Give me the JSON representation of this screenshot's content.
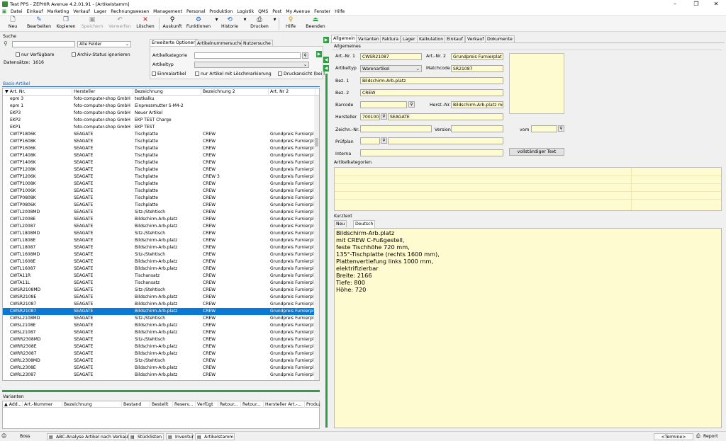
{
  "window": {
    "title": "Test PPS - ZEPHIR Avenue 4.2.01.91 - [Artikelstamm]",
    "controls": [
      "–",
      "❐",
      "✕"
    ]
  },
  "menu": [
    "Datei",
    "Einkauf",
    "Marketing",
    "Verkauf",
    "Lager",
    "Rechnungswesen",
    "Management",
    "Personal",
    "Produktion",
    "Logistik",
    "QMS",
    "Post",
    "My Avenue",
    "Fenster",
    "Hilfe"
  ],
  "toolbar": {
    "neu": "Neu",
    "bearbeiten": "Bearbeiten",
    "kopieren": "Kopieren",
    "speichern": "Speichern",
    "verwerfen": "Verwerfen",
    "loeschen": "Löschen",
    "auskunft": "Auskunft",
    "funktionen": "Funktionen",
    "historie": "Historie",
    "drucken": "Drucken",
    "hilfe": "Hilfe",
    "beenden": "Beenden"
  },
  "search": {
    "label": "Suche",
    "value": "",
    "field_select": "Alle Felder",
    "nur_verfuegbare": "nur Verfügbare",
    "archiv_status": "Archiv-Status ignorieren",
    "datensaetze_label": "Datensätze:",
    "datensaetze": "1616",
    "tabs": [
      "Erweiterte Optionen",
      "Artikelnummersuche",
      "Nutzersuche"
    ],
    "artikelkategorie_label": "Artikelkategorie",
    "artikeltyp_label": "Artikeltyp",
    "einmalartikel": "Einmalartikel",
    "loeschmarkierung": "nur Artikel mit Löschmarkierung",
    "druckansicht": "Druckansicht (bei l"
  },
  "grid": {
    "section_title": "Basis-Artikel",
    "columns": [
      "▼ Art. Nr.",
      "Hersteller",
      "Bezeichnung",
      "Bezeichnung 2",
      "Art. Nr 2"
    ],
    "selected_index": 30,
    "rows": [
      [
        "epm 3",
        "foto-computer-shop GmbH",
        "testkalku",
        "",
        ""
      ],
      [
        "epm 1",
        "foto-computer-shop GmbH",
        "Einpressmutter S-M4-2",
        "",
        ""
      ],
      [
        "EKP3",
        "foto-computer-shop GmbH",
        "Neuer Artikel",
        "",
        ""
      ],
      [
        "EKP2",
        "foto-computer-shop GmbH",
        "EKP TEST Charge",
        "",
        ""
      ],
      [
        "EKP1",
        "foto-computer-shop GmbH",
        "EKP TEST",
        "",
        ""
      ],
      [
        "CWTP1806K",
        "SEAGATE",
        "Tischplatte",
        "CREW",
        "Grundpreis Furnierpl"
      ],
      [
        "CWTP1608K",
        "SEAGATE",
        "Tischplatte",
        "CREW",
        "Grundpreis Furnierpl"
      ],
      [
        "CWTP1606K",
        "SEAGATE",
        "Tischplatte",
        "CREW",
        "Grundpreis Furnierpl"
      ],
      [
        "CWTP1408K",
        "SEAGATE",
        "Tischplatte",
        "CREW",
        "Grundpreis Furnierpl"
      ],
      [
        "CWTP1406K",
        "SEAGATE",
        "Tischplatte",
        "CREW",
        "Grundpreis Furnierpl"
      ],
      [
        "CWTP1208K",
        "SEAGATE",
        "Tischplatte",
        "CREW",
        "Grundpreis Furnierpl"
      ],
      [
        "CWTP1206K",
        "SEAGATE",
        "Tischplatte",
        "CREW 3",
        "Grundpreis Furnierpl"
      ],
      [
        "CWTP1008K",
        "SEAGATE",
        "Tischplatte",
        "CREW",
        "Grundpreis Furnierpl"
      ],
      [
        "CWTP1006K",
        "SEAGATE",
        "Tischplatte",
        "CREW",
        "Grundpreis Furnierpl"
      ],
      [
        "CWTP0808K",
        "SEAGATE",
        "Tischplatte",
        "CREW",
        "Grundpreis Furnierpl"
      ],
      [
        "CWTP0806K",
        "SEAGATE",
        "Tischplatte",
        "CREW",
        "Grundpreis Furnierpl"
      ],
      [
        "CWTL2008MD",
        "SEAGATE",
        "Sitz-/Stehtisch",
        "CREW",
        "Grundpreis Furnierpl"
      ],
      [
        "CWTL2008E",
        "SEAGATE",
        "Bildschirm-Arb.platz",
        "CREW",
        "Grundpreis Furnierpl"
      ],
      [
        "CWTL20087",
        "SEAGATE",
        "Bildschirm-Arb.platz",
        "CREW",
        "Grundpreis Furnierpl"
      ],
      [
        "CWTL1808MD",
        "SEAGATE",
        "Sitz-/Stehtisch",
        "CREW",
        "Grundpreis Furnierpl"
      ],
      [
        "CWTL1808E",
        "SEAGATE",
        "Bildschirm-Arb.platz",
        "CREW",
        "Grundpreis Furnierpl"
      ],
      [
        "CWTL18087",
        "SEAGATE",
        "Bildschirm-Arb.platz",
        "CREW",
        "Grundpreis Furnierpl"
      ],
      [
        "CWTL1608MD",
        "SEAGATE",
        "Sitz-/Stehtisch",
        "CREW",
        "Grundpreis Furnierpl"
      ],
      [
        "CWTL1608E",
        "SEAGATE",
        "Bildschirm-Arb.platz",
        "CREW",
        "Grundpreis Furnierpl"
      ],
      [
        "CWTL16087",
        "SEAGATE",
        "Bildschirm-Arb.platz",
        "CREW",
        "Grundpreis Furnierpl"
      ],
      [
        "CWTA11R",
        "SEAGATE",
        "Tischansatz",
        "CREW",
        "Grundpreis Furnierpl"
      ],
      [
        "CWTA11L",
        "SEAGATE",
        "Tischansatz",
        "CREW",
        "Grundpreis Furnierpl"
      ],
      [
        "CWSR2108MD",
        "SEAGATE",
        "Sitz-/Stehtisch",
        "CREW",
        "Grundpreis Furnierpl"
      ],
      [
        "CWSR2108E",
        "SEAGATE",
        "Bildschirm-Arb.platz",
        "CREW",
        "Grundpreis Furnierpl"
      ],
      [
        "CWSR21087",
        "SEAGATE",
        "Bildschirm-Arb.platz",
        "CREW",
        "Grundpreis Furnierpl"
      ],
      [
        "CWSR21087",
        "SEAGATE",
        "Bildschirm-Arb.platz",
        "CREW",
        "Grundpreis Furnierpl"
      ],
      [
        "CWSL2108MD",
        "SEAGATE",
        "Sitz-/Stehtisch",
        "CREW",
        "Grundpreis Furnierpl"
      ],
      [
        "CWSL2108E",
        "SEAGATE",
        "Bildschirm-Arb.platz",
        "CREW",
        "Grundpreis Furnierpl"
      ],
      [
        "CWSL21087",
        "SEAGATE",
        "Bildschirm-Arb.platz",
        "CREW",
        "Grundpreis Furnierpl"
      ],
      [
        "CWRR2308MD",
        "SEAGATE",
        "Sitz-/Stehtisch",
        "CREW",
        "Grundpreis Furnierpl"
      ],
      [
        "CWRR2308E",
        "SEAGATE",
        "Bildschirm-Arb.platz",
        "CREW",
        "Grundpreis Furnierpl"
      ],
      [
        "CWRR23087",
        "SEAGATE",
        "Bildschirm-Arb.platz",
        "CREW",
        "Grundpreis Furnierpl"
      ],
      [
        "CWRL2308MD",
        "SEAGATE",
        "Sitz-/Stehtisch",
        "CREW",
        "Grundpreis Furnierpl"
      ],
      [
        "CWRL2308E",
        "SEAGATE",
        "Bildschirm-Arb.platz",
        "CREW",
        "Grundpreis Furnierpl"
      ],
      [
        "CWRL23087",
        "SEAGATE",
        "Bildschirm-Arb.platz",
        "CREW",
        "Grundpreis Furnierpl"
      ]
    ]
  },
  "variants": {
    "title": "Varianten",
    "columns": [
      "▲ Add...",
      "Art.-Nummer",
      "Bezeichnung",
      "Bestand",
      "Bestellt",
      "Reserv...",
      "Verfügt",
      "Retour...",
      "Retour...",
      "Hersteller Art.-...",
      "Produz"
    ]
  },
  "detail": {
    "tabs": [
      "Allgemein",
      "Varianten",
      "Faktura",
      "Lager",
      "Kalkulation",
      "Einkauf",
      "Verkauf",
      "Dokumente"
    ],
    "section": "Allgemeines",
    "artnr1_label": "Art.-Nr. 1",
    "artnr1": "CWSR21087",
    "artnr2_label": "Art.-Nr. 2",
    "artnr2": "Grundpreis Furnierplat",
    "artikeltyp_label": "Artikeltyp",
    "artikeltyp": "Warenartikel",
    "matchcode_label": "Matchcode",
    "matchcode": "SR21087",
    "bez1_label": "Bez. 1",
    "bez1": "Bildschirm-Arb.platz",
    "bez2_label": "Bez. 2",
    "bez2": "CREW",
    "barcode_label": "Barcode",
    "barcode": "",
    "herstnr_label": "Herst.-Nr.",
    "herstnr": "Bildschirm-Arb.platz mit",
    "hersteller_label": "Hersteller",
    "hersteller_nr": "700100",
    "hersteller_name": "SEAGATE",
    "zeichnr_label": "Zeichn.-Nr.",
    "version_label": "Version",
    "vom_label": "vom",
    "pruefplan_label": "Prüfplan",
    "interna_label": "Interna",
    "volltext_button": "vollständiger Text",
    "kategorien_label": "Artikelkategorien",
    "kurztext_label": "Kurztext",
    "kurztext_tabs": [
      "Neu",
      "Deutsch"
    ],
    "kurztext_lines": [
      "Bildschirm-Arb.platz",
      "mit CREW C-Fußgestell,",
      "feste Tischhöhe 720 mm,",
      "135°-Tischplatte (rechts 1600 mm),",
      "Plattenvertiefung links 1000 mm,",
      "elektrifizierbar",
      "Breite: 2166",
      "Tiefe: 800",
      "Höhe: 720"
    ]
  },
  "statusbar": {
    "user": "Boss",
    "tabs": [
      "ABC-Analyse Artikel nach Verkauf",
      "Stücklisten",
      "Inventur",
      "Artikelstamm"
    ],
    "termine": "<Termine>",
    "report": "Report"
  },
  "colors": {
    "selection": "#0a78d7",
    "field_yellow": "#fffbd0",
    "accent_green": "#2f9e44",
    "section_blue": "#1b5fb7"
  }
}
